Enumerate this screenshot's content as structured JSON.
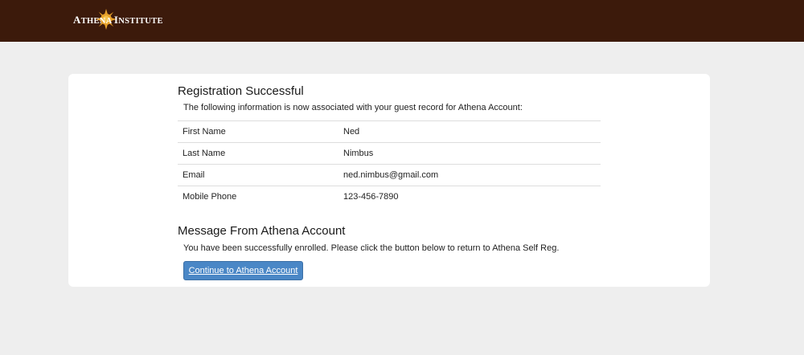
{
  "header": {
    "logo_text_a": "A",
    "logo_text_rest": "thena ",
    "logo_text_i": "I",
    "logo_text_end": "nstitute",
    "logo_icon": "sun-logo-icon",
    "background_color": "#3c1a0b"
  },
  "registration": {
    "heading": "Registration Successful",
    "description": "The following information is now associated with your guest record for Athena Account:",
    "fields": [
      {
        "label": "First Name",
        "value": "Ned"
      },
      {
        "label": "Last Name",
        "value": "Nimbus"
      },
      {
        "label": "Email",
        "value": "ned.nimbus@gmail.com"
      },
      {
        "label": "Mobile Phone",
        "value": "123-456-7890"
      }
    ]
  },
  "message": {
    "heading": "Message From Athena Account",
    "text": "You have been successfully enrolled. Please click the button below to return to Athena Self Reg.",
    "button_label": "Continue to Athena Account",
    "button_color": "#4a87c6"
  }
}
